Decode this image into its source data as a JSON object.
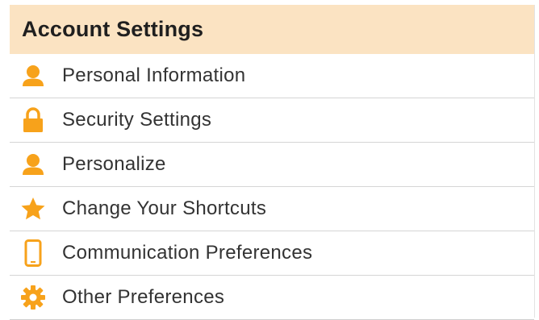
{
  "header": {
    "title": "Account Settings"
  },
  "menu": {
    "items": [
      {
        "label": "Personal Information",
        "icon": "person-icon"
      },
      {
        "label": "Security Settings",
        "icon": "lock-icon"
      },
      {
        "label": "Personalize",
        "icon": "person-icon"
      },
      {
        "label": "Change Your Shortcuts",
        "icon": "star-icon"
      },
      {
        "label": "Communication Preferences",
        "icon": "mobile-phone-icon"
      },
      {
        "label": "Other Preferences",
        "icon": "gear-icon"
      }
    ]
  },
  "colors": {
    "header_background": "#fbe3c2",
    "icon_accent": "#f7a21b",
    "divider": "#d5d5d5",
    "text": "#333333"
  }
}
